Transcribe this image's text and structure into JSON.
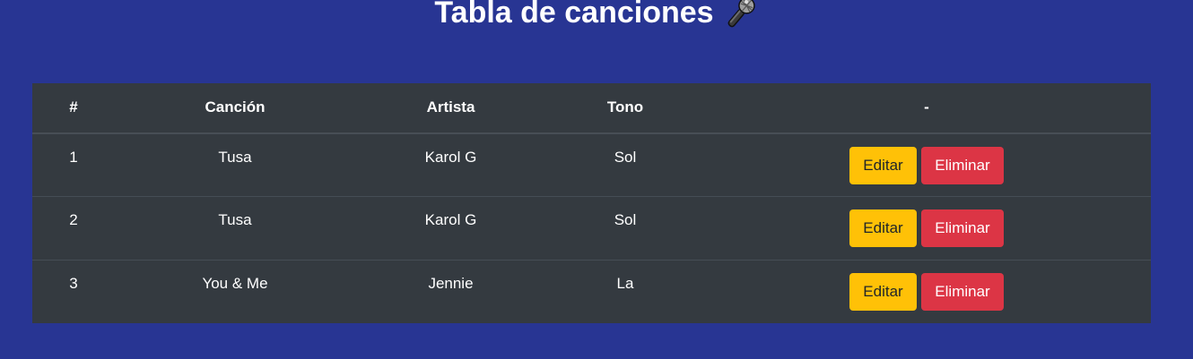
{
  "page": {
    "title": "Tabla de canciones",
    "title_icon": "microphone-icon"
  },
  "table": {
    "headers": {
      "number": "#",
      "song": "Canción",
      "artist": "Artista",
      "tone": "Tono",
      "actions": "-"
    },
    "rows": [
      {
        "number": "1",
        "song": "Tusa",
        "artist": "Karol G",
        "tone": "Sol"
      },
      {
        "number": "2",
        "song": "Tusa",
        "artist": "Karol G",
        "tone": "Sol"
      },
      {
        "number": "3",
        "song": "You & Me",
        "artist": "Jennie",
        "tone": "La"
      }
    ],
    "edit_label": "Editar",
    "delete_label": "Eliminar"
  },
  "colors": {
    "background": "#283593",
    "table_background": "#343a40",
    "edit_button": "#ffc107",
    "delete_button": "#dc3545"
  }
}
